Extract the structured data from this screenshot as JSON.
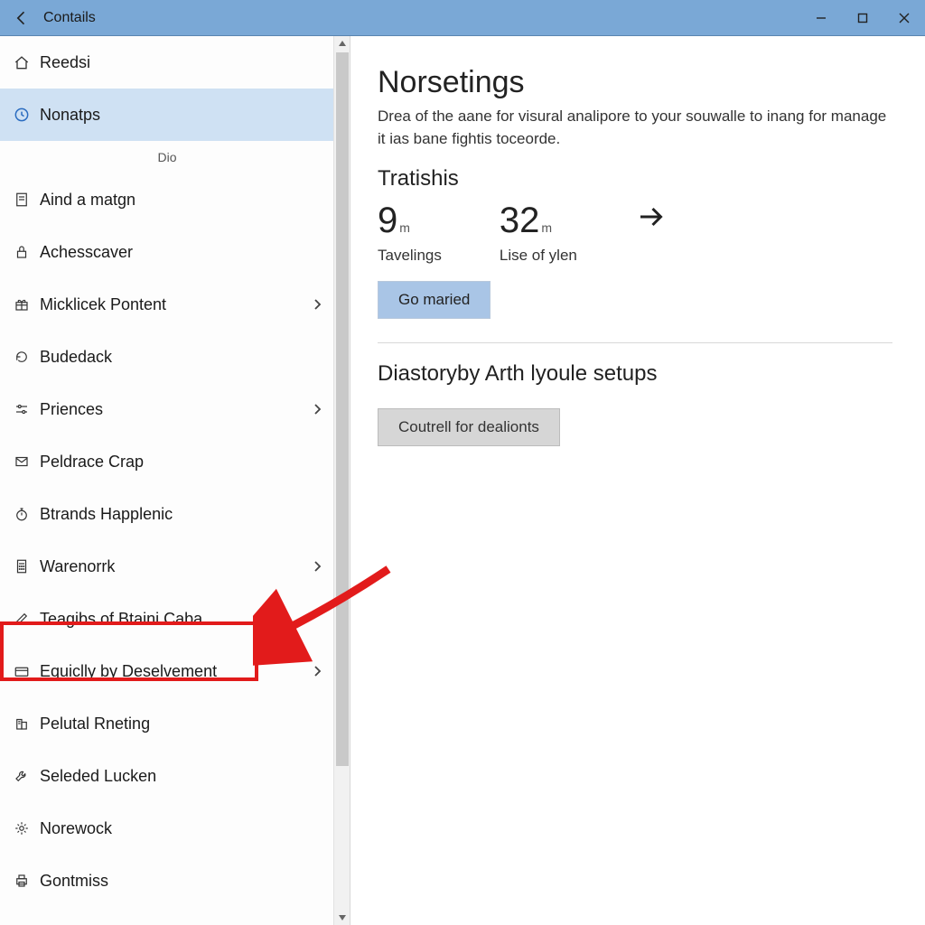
{
  "titlebar": {
    "title": "Contails"
  },
  "sidebar": {
    "items": [
      {
        "label": "Reedsi"
      },
      {
        "label": "Nonatps"
      }
    ],
    "section_label": "Dio",
    "group": [
      {
        "label": "Aind a matgn",
        "chevron": false
      },
      {
        "label": "Achesscaver",
        "chevron": false
      },
      {
        "label": "Micklicek Pontent",
        "chevron": true
      },
      {
        "label": "Budedack",
        "chevron": false
      },
      {
        "label": "Priences",
        "chevron": true
      },
      {
        "label": "Peldrace Crap",
        "chevron": false
      },
      {
        "label": "Btrands Happlenic",
        "chevron": false
      },
      {
        "label": "Warenorrk",
        "chevron": true
      },
      {
        "label": "Teagibs of Btaini Caba",
        "chevron": false
      },
      {
        "label": "Equiclly by Deselvement",
        "chevron": true
      },
      {
        "label": "Pelutal Rneting",
        "chevron": false
      },
      {
        "label": "Seleded Lucken",
        "chevron": false
      },
      {
        "label": "Norewock",
        "chevron": false
      },
      {
        "label": "Gontmiss",
        "chevron": false
      }
    ]
  },
  "content": {
    "heading": "Norsetings",
    "description": "Drea of the aane for visural analipore to your souwalle to inang for manage it ias bane fightis toceorde.",
    "stats_title": "Tratishis",
    "stat1_value": "9",
    "stat1_unit": "m",
    "stat1_label": "Tavelings",
    "stat2_value": "32",
    "stat2_unit": "m",
    "stat2_label": "Lise of ylen",
    "primary_button": "Go maried",
    "section2_title": "Diastoryby Arth lyoule setups",
    "secondary_button": "Coutrell for dealionts"
  }
}
